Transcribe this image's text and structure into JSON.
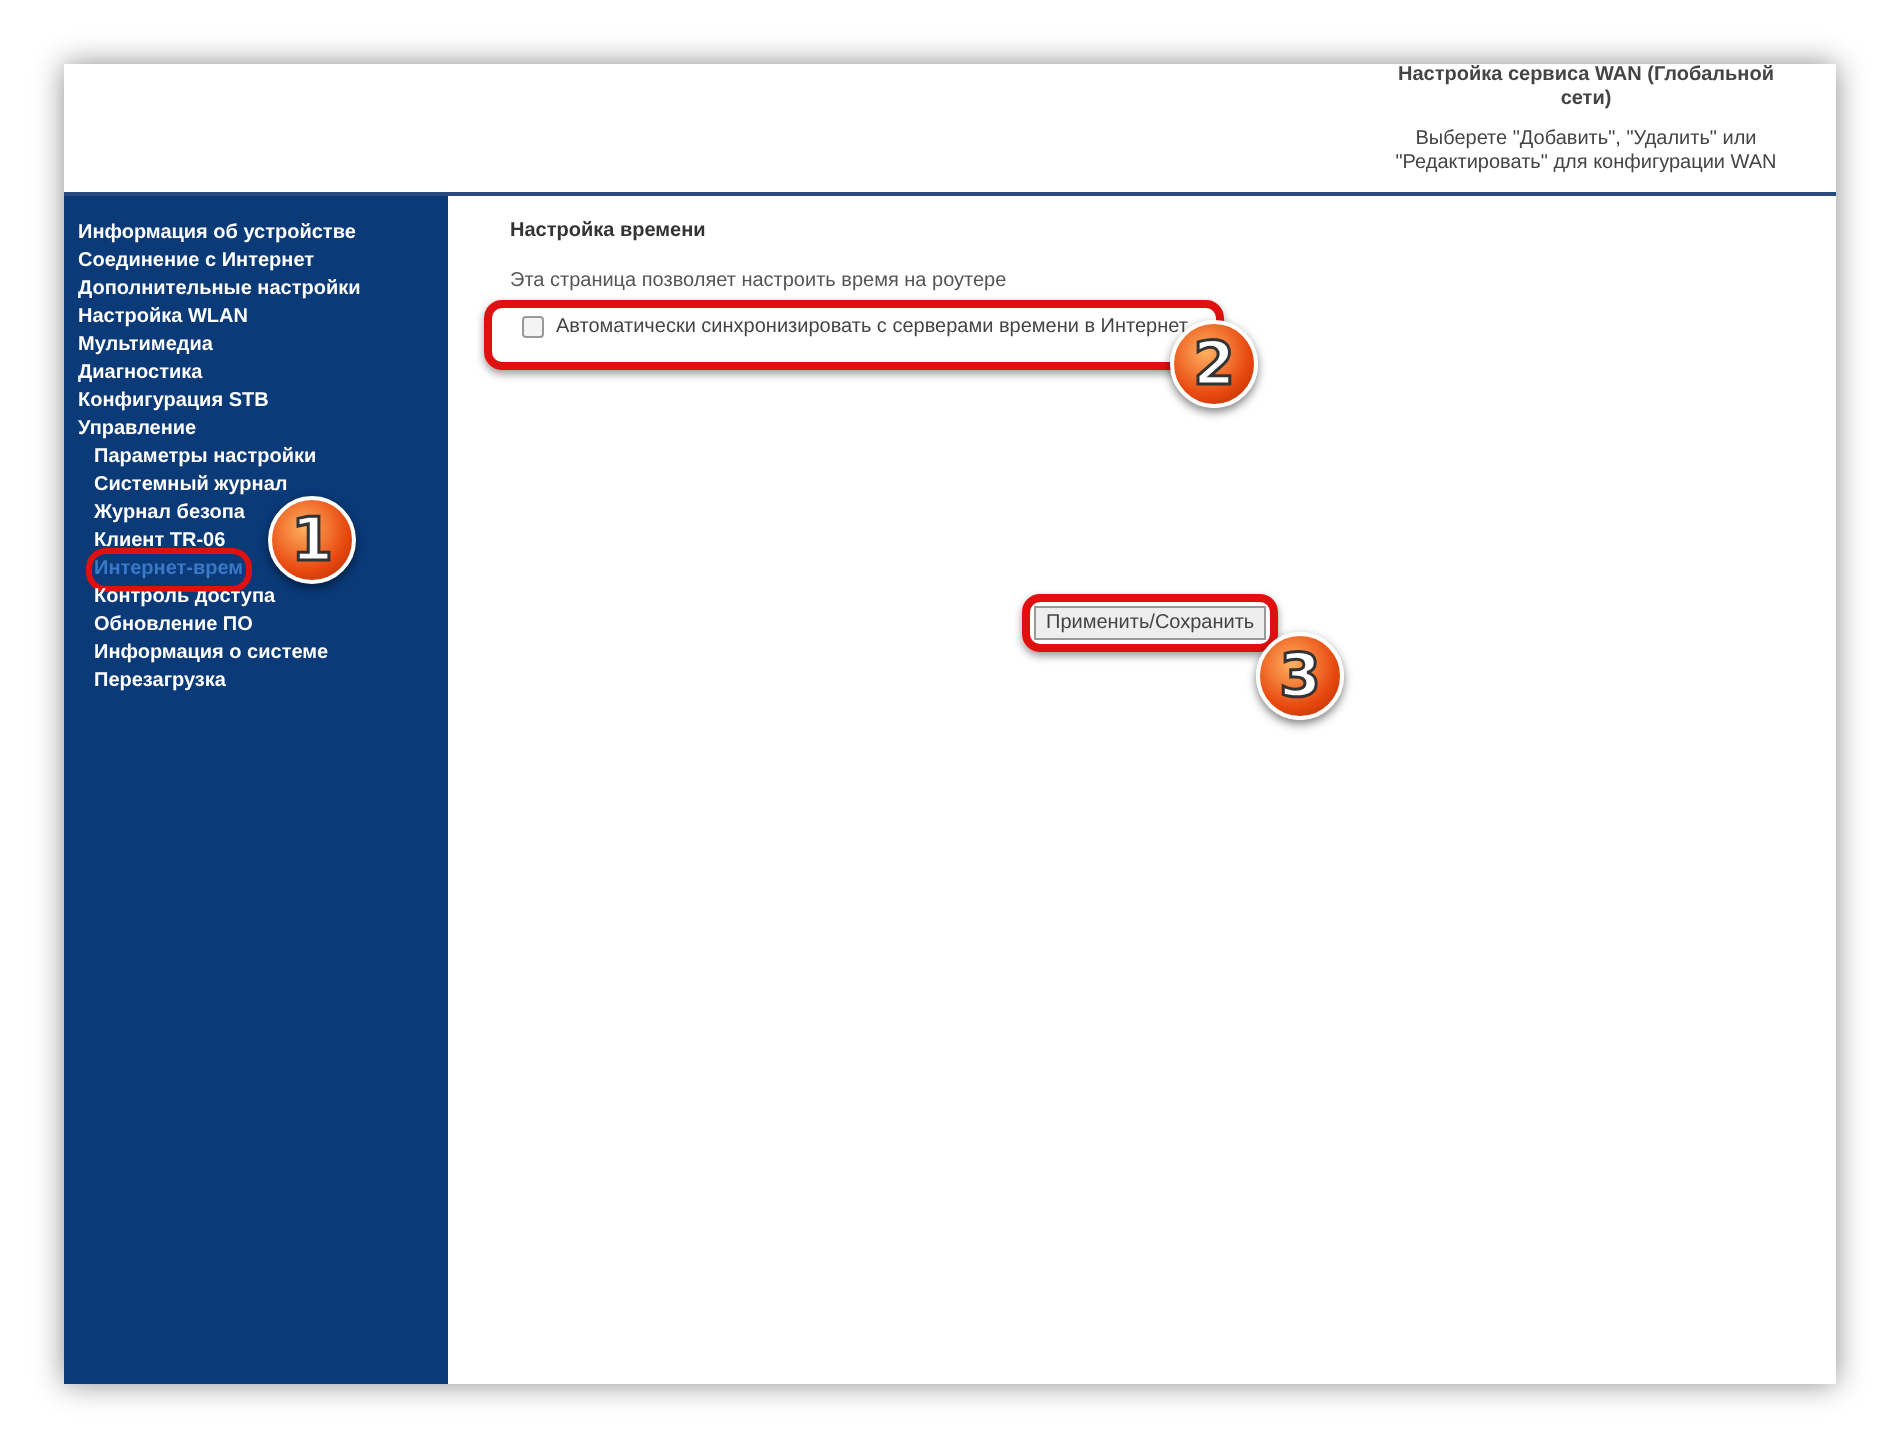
{
  "header": {
    "title": "Настройка сервиса WAN (Глобальной сети)",
    "description": "Выберете \"Добавить\", \"Удалить\" или \"Редактировать\" для конфигурации WAN"
  },
  "sidebar": {
    "items": [
      {
        "label": "Информация об устройстве",
        "selected": false
      },
      {
        "label": "Соединение с Интернет",
        "selected": false
      },
      {
        "label": "Дополнительные настройки",
        "selected": false
      },
      {
        "label": "Настройка WLAN",
        "selected": false
      },
      {
        "label": "Мультимедиа",
        "selected": false
      },
      {
        "label": "Диагностика",
        "selected": false
      },
      {
        "label": "Конфигурация STB",
        "selected": false
      },
      {
        "label": "Управление",
        "selected": false,
        "children": [
          {
            "label": "Параметры настройки",
            "selected": false
          },
          {
            "label": "Системный журнал",
            "selected": false
          },
          {
            "label": "Журнал безопа",
            "selected": false
          },
          {
            "label": "Клиент TR-06",
            "selected": false
          },
          {
            "label": "Интернет-врем",
            "selected": true
          },
          {
            "label": "Контроль доступа",
            "selected": false
          },
          {
            "label": "Обновление ПО",
            "selected": false
          },
          {
            "label": "Информация о системе",
            "selected": false
          },
          {
            "label": "Перезагрузка",
            "selected": false
          }
        ]
      }
    ]
  },
  "content": {
    "title": "Настройка времени",
    "description": "Эта страница позволяет настроить время на роутере",
    "sync_checkbox": {
      "label": "Автоматически синхронизировать с серверами времени в Интернет",
      "checked": false
    },
    "apply_button": "Применить/Сохранить"
  },
  "annotations": [
    "1",
    "2",
    "3"
  ]
}
